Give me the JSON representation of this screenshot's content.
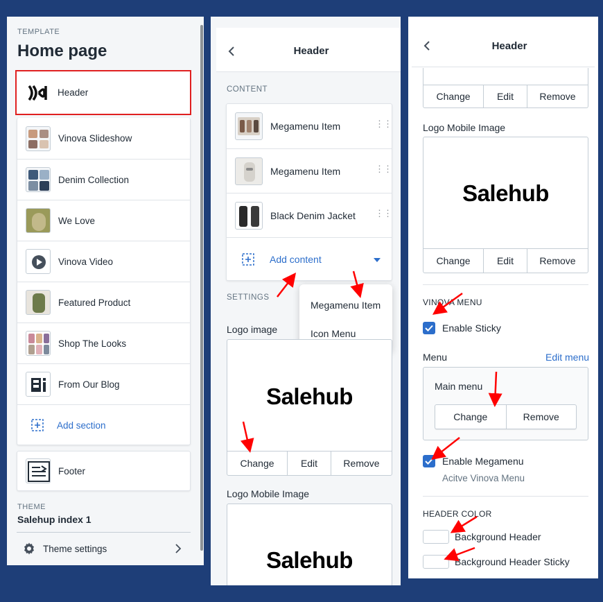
{
  "left_panel": {
    "template_caption": "TEMPLATE",
    "page_title": "Home page",
    "sections": [
      {
        "label": "Header"
      },
      {
        "label": "Vinova Slideshow"
      },
      {
        "label": "Denim Collection"
      },
      {
        "label": "We Love"
      },
      {
        "label": "Vinova Video"
      },
      {
        "label": "Featured Product"
      },
      {
        "label": "Shop The Looks"
      },
      {
        "label": "From Our Blog"
      }
    ],
    "add_section_label": "Add section",
    "footer_label": "Footer",
    "theme_caption": "THEME",
    "theme_name": "Salehup index 1",
    "theme_settings_label": "Theme settings"
  },
  "middle_panel": {
    "title": "Header",
    "content_caption": "CONTENT",
    "blocks": [
      {
        "label": "Megamenu Item"
      },
      {
        "label": "Megamenu Item"
      },
      {
        "label": "Black Denim Jacket"
      }
    ],
    "add_content_label": "Add content",
    "dropdown_options": [
      "Megamenu Item",
      "Icon Menu"
    ],
    "settings_caption": "SETTINGS",
    "logo_image_label": "Logo image",
    "logo_text": "Salehub",
    "buttons": {
      "change": "Change",
      "edit": "Edit",
      "remove": "Remove"
    },
    "logo_mobile_label": "Logo Mobile Image",
    "logo_mobile_text": "Salehub"
  },
  "right_panel": {
    "title": "Header",
    "buttons": {
      "change": "Change",
      "edit": "Edit",
      "remove": "Remove"
    },
    "logo_mobile_label": "Logo Mobile Image",
    "logo_mobile_text": "Salehub",
    "vinova_menu_caption": "VINOVA MENU",
    "enable_sticky_label": "Enable Sticky",
    "menu_label": "Menu",
    "edit_menu_link": "Edit menu",
    "menu_name": "Main menu",
    "menu_change": "Change",
    "menu_remove": "Remove",
    "enable_megamenu_label": "Enable Megamenu",
    "megamenu_help": "Acitve Vinova Menu",
    "header_color_caption": "HEADER COLOR",
    "background_header_label": "Background Header",
    "background_sticky_label": "Background Header Sticky"
  },
  "colors": {
    "background": "#1e3e78",
    "accent": "#2c6ecb",
    "highlight": "#e02020",
    "annotation_arrow": "#ff0000"
  }
}
